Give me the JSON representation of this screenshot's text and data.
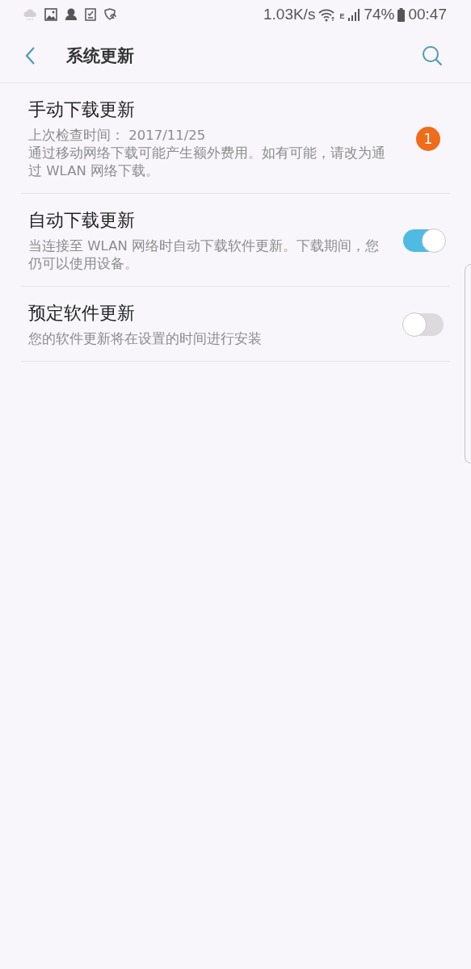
{
  "status_bar": {
    "speed": "1.03K/s",
    "network_type": "E",
    "battery": "74%",
    "time": "00:47"
  },
  "header": {
    "title": "系统更新"
  },
  "items": [
    {
      "kind": "badge",
      "title": "手动下载更新",
      "subtitle": "上次检查时间： 2017/11/25",
      "description": "通过移动网络下载可能产生额外费用。如有可能，请改为通过 WLAN 网络下载。",
      "badge": "1"
    },
    {
      "kind": "switch",
      "title": "自动下载更新",
      "description": "当连接至 WLAN 网络时自动下载软件更新。下载期间，您仍可以使用设备。",
      "on": true
    },
    {
      "kind": "switch",
      "title": "预定软件更新",
      "description": "您的软件更新将在设置的时间进行安装",
      "on": false
    }
  ]
}
